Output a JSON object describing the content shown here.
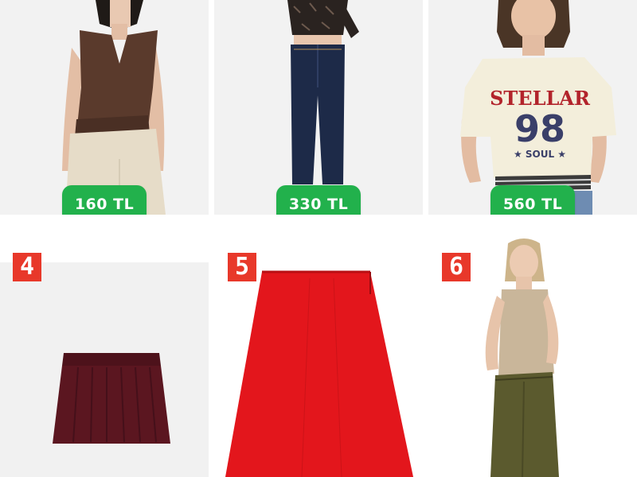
{
  "products": [
    {
      "price": "160 TL"
    },
    {
      "price": "330 TL"
    },
    {
      "price": "560 TL",
      "print": {
        "line1": "STELLAR",
        "line2": "98",
        "line3": "★ SOUL ★"
      }
    },
    {
      "number": "4"
    },
    {
      "number": "5"
    },
    {
      "number": "6"
    }
  ],
  "colors": {
    "price_badge": "#22b14c",
    "number_badge": "#e8382a",
    "skirt_burgundy": "#5b1620",
    "skirt_red": "#e3161c",
    "pants_olive": "#5b5a2e"
  }
}
